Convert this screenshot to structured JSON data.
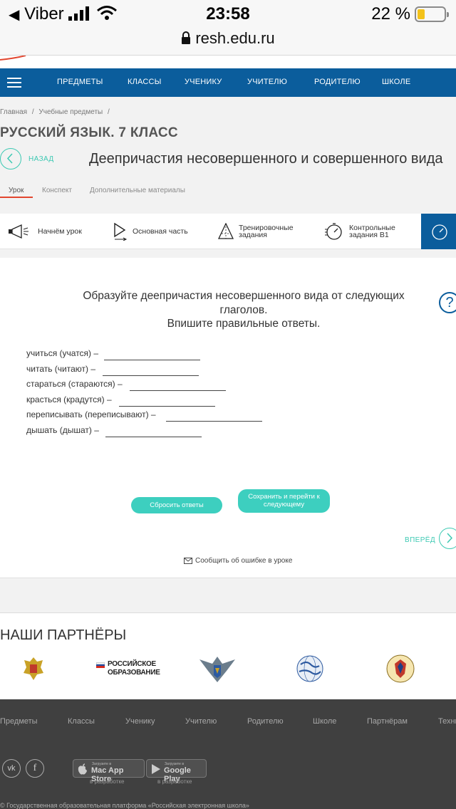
{
  "status_bar": {
    "carrier": "Viber",
    "time": "23:58",
    "battery": "22 %"
  },
  "browser": {
    "url": "resh.edu.ru"
  },
  "nav": {
    "items": [
      "ПРЕДМЕТЫ",
      "КЛАССЫ",
      "УЧЕНИКУ",
      "УЧИТЕЛЮ",
      "РОДИТЕЛЮ",
      "ШКОЛЕ"
    ]
  },
  "breadcrumbs": [
    "Главная",
    "/",
    "Учебные предметы",
    "/"
  ],
  "subject": "РУССКИЙ ЯЗЫК. 7 КЛАСС",
  "back_label": "НАЗАД",
  "lesson_title": "Деепричастия несовершенного и совершенного вида",
  "tabs": [
    "Урок",
    "Конспект",
    "Дополнительные материалы"
  ],
  "steps": [
    {
      "label": "Начнём урок",
      "icon": "megaphone-icon"
    },
    {
      "label": "Основная часть",
      "icon": "play-icon"
    },
    {
      "label": "Тренировочные\nзадания",
      "icon": "pyramid-icon"
    },
    {
      "label": "Контрольные\nзадания В1",
      "icon": "stopwatch-icon"
    }
  ],
  "task": {
    "line1": "Образуйте деепричастия несовершенного вида от следующих",
    "line2": "глаголов.",
    "line3": "Впишите правильные ответы.",
    "questions": [
      "учиться (учатся) –",
      "читать (читают) –",
      "стараться (стараются) –",
      "красться (крадутся) –",
      "переписывать (переписывают) –",
      "дышать (дышат) –"
    ]
  },
  "buttons": {
    "reset": "Сбросить ответы",
    "save_line1": "Сохранить и перейти к",
    "save_line2": "следующему"
  },
  "forward_label": "ВПЕРЁД",
  "report_error": "Сообщить об ошибке в уроке",
  "partners": {
    "title": "НАШИ ПАРТНЁРЫ",
    "ros_obr_line1": "РОССИЙСКОЕ",
    "ros_obr_line2": "ОБРАЗОВАНИЕ"
  },
  "footer": {
    "links": [
      "Предметы",
      "Классы",
      "Ученику",
      "Учителю",
      "Родителю",
      "Школе",
      "Партнёрам",
      "Техни"
    ],
    "social": [
      "vk-icon",
      "facebook-icon"
    ],
    "app_store": {
      "small": "Загрузите в",
      "name": "Mac App Store",
      "status": "в разработке"
    },
    "google_play": {
      "small": "Загрузите в",
      "name": "Google Play",
      "status": "в разработке"
    },
    "copyright": "© Государственная образовательная платформа «Российская электронная школа»"
  },
  "colors": {
    "nav": "#0b5d9c",
    "accent": "#3dcfbf",
    "tab_underline": "#e2462f",
    "footer": "#404040"
  }
}
